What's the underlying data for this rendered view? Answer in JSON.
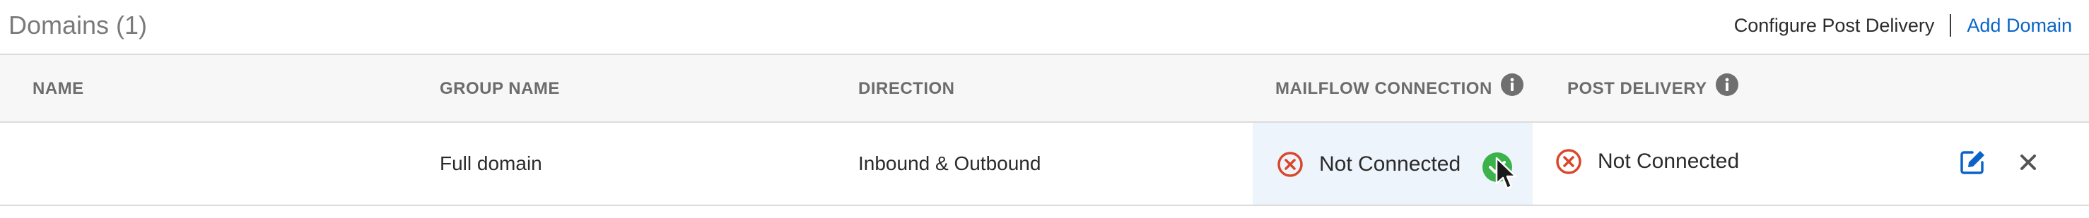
{
  "header": {
    "title": "Domains (1)",
    "configure_label": "Configure Post Delivery",
    "add_label": "Add Domain"
  },
  "table": {
    "columns": [
      "NAME",
      "GROUP NAME",
      "DIRECTION",
      "MAILFLOW CONNECTION",
      "POST DELIVERY"
    ],
    "rows": [
      {
        "name": "",
        "group_name": "Full domain",
        "direction": "Inbound & Outbound",
        "mailflow_status": "Not Connected",
        "post_delivery_status": "Not Connected"
      }
    ]
  },
  "colors": {
    "accent": "#0a64c8",
    "error": "#d9462b",
    "success": "#3bb34a",
    "header_bg": "#f7f7f7",
    "highlight_bg": "#eef4fb"
  },
  "icons": [
    "info-icon",
    "x-circle-icon",
    "check-circle-icon",
    "edit-icon",
    "close-icon",
    "mouse-cursor-icon"
  ]
}
